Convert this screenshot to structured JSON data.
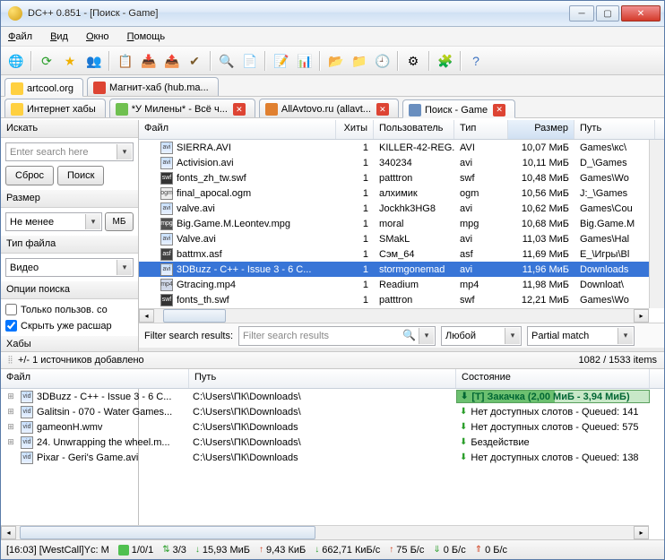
{
  "window": {
    "title": "DC++ 0.851 - [Поиск - Game]"
  },
  "menu": {
    "file": "Файл",
    "view": "Вид",
    "window": "Окно",
    "help": "Помощь"
  },
  "tabs1": [
    {
      "label": "artcool.org",
      "color": "#ffd040"
    },
    {
      "label": "Магнит-хаб (hub.ma...",
      "color": "#d43"
    }
  ],
  "tabs2": [
    {
      "label": "Интернет хабы",
      "color": "#ffd040"
    },
    {
      "label": "*У Милены* - Всё ч...",
      "color": "#70c050",
      "closable": true
    },
    {
      "label": "AllAvtovo.ru (allavt...",
      "color": "#e08030",
      "closable": true
    },
    {
      "label": "Поиск - Game",
      "color": "#6a8fbf",
      "closable": true,
      "active": true
    }
  ],
  "sidebar": {
    "search_hdr": "Искать",
    "search_placeholder": "Enter search here",
    "reset": "Сброс",
    "go": "Поиск",
    "size_hdr": "Размер",
    "size_mode": "Не менее",
    "size_unit": "МБ",
    "type_hdr": "Тип файла",
    "type_val": "Видео",
    "opts_hdr": "Опции поиска",
    "opt_only_users": "Только пользов. со",
    "opt_hide_shared": "Скрыть уже расшар",
    "hubs_hdr": "Хабы"
  },
  "grid": {
    "cols": {
      "file": "Файл",
      "hits": "Хиты",
      "user": "Пользователь",
      "type": "Тип",
      "size": "Размер",
      "path": "Путь"
    },
    "rows": [
      {
        "f": "SIERRA.AVI",
        "h": "1",
        "u": "KILLER-42-REG...",
        "t": "AVI",
        "s": "10,07 МиБ",
        "p": "Games\\кс\\",
        "ic": "avi"
      },
      {
        "f": "Activision.avi",
        "h": "1",
        "u": "340234",
        "t": "avi",
        "s": "10,11 МиБ",
        "p": "D_\\Games",
        "ic": "avi"
      },
      {
        "f": "fonts_zh_tw.swf",
        "h": "1",
        "u": "patttron",
        "t": "swf",
        "s": "10,48 МиБ",
        "p": "Games\\Wo",
        "ic": "swf"
      },
      {
        "f": "final_apocal.ogm",
        "h": "1",
        "u": "алхимик",
        "t": "ogm",
        "s": "10,56 МиБ",
        "p": "J:_\\Games",
        "ic": "ogm"
      },
      {
        "f": "valve.avi",
        "h": "1",
        "u": "Jockhk3HG8",
        "t": "avi",
        "s": "10,62 МиБ",
        "p": "Games\\Cou",
        "ic": "avi"
      },
      {
        "f": "Big.Game.M.Leontev.mpg",
        "h": "1",
        "u": "moral",
        "t": "mpg",
        "s": "10,68 МиБ",
        "p": "Big.Game.M",
        "ic": "mpg"
      },
      {
        "f": "Valve.avi",
        "h": "1",
        "u": "SMakL",
        "t": "avi",
        "s": "11,03 МиБ",
        "p": "Games\\Hal",
        "ic": "avi"
      },
      {
        "f": "battmx.asf",
        "h": "1",
        "u": "Сэм_64",
        "t": "asf",
        "s": "11,69 МиБ",
        "p": "E_\\Игры\\Bl",
        "ic": "asf"
      },
      {
        "f": "3DBuzz - C++ - Issue 3 - 6 C...",
        "h": "1",
        "u": "stormgonemad",
        "t": "avi",
        "s": "11,96 МиБ",
        "p": "Downloads",
        "ic": "avi",
        "sel": true
      },
      {
        "f": "Gtracing.mp4",
        "h": "1",
        "u": "Readium",
        "t": "mp4",
        "s": "11,98 МиБ",
        "p": "Downloat\\",
        "ic": "mp4"
      },
      {
        "f": "fonts_th.swf",
        "h": "1",
        "u": "patttron",
        "t": "swf",
        "s": "12,21 МиБ",
        "p": "Games\\Wo",
        "ic": "swf"
      }
    ]
  },
  "filterbar": {
    "label": "Filter search results:",
    "placeholder": "Filter search results",
    "col": "Любой",
    "match": "Partial match"
  },
  "midstatus": {
    "left": "+/-  1 источников добавлено",
    "right": "1082 / 1533 items"
  },
  "dl": {
    "cols": {
      "file": "Файл",
      "path": "Путь",
      "state": "Состояние"
    },
    "rows": [
      {
        "f": "3DBuzz - C++ - Issue 3 - 6 C...",
        "p": "C:\\Users\\ПК\\Downloads\\",
        "st": "[T] Закачка (2,00 МиБ - 3,94 МиБ)",
        "kind": "prog",
        "tree": "⊞"
      },
      {
        "f": "Galitsin - 070 - Water Games...",
        "p": "C:\\Users\\ПК\\Downloads\\",
        "st": "Нет доступных слотов - Queued: 141",
        "kind": "q",
        "tree": "⊞"
      },
      {
        "f": "gameonH.wmv",
        "p": "C:\\Users\\ПК\\Downloads",
        "st": "Нет доступных слотов - Queued: 575",
        "kind": "q",
        "tree": "⊞"
      },
      {
        "f": "24. Unwrapping the wheel.m...",
        "p": "C:\\Users\\ПК\\Downloads\\",
        "st": "Бездействие",
        "kind": "idle",
        "tree": "⊞"
      },
      {
        "f": "Pixar - Geri's Game.avi",
        "p": "C:\\Users\\ПК\\Downloads",
        "st": "Нет доступных слотов - Queued: 138",
        "kind": "q",
        "tree": " "
      }
    ]
  },
  "bottom": {
    "log": "[16:03] [WestCall]Yc: M",
    "conns": "1/0/1",
    "slots": "3/3",
    "dl": "15,93 МиБ",
    "ul": "9,43 КиБ",
    "dlr": "662,71 КиБ/с",
    "ulr": "75 Б/с",
    "dlr2": "0 Б/с",
    "ulr2": "0 Б/с"
  }
}
